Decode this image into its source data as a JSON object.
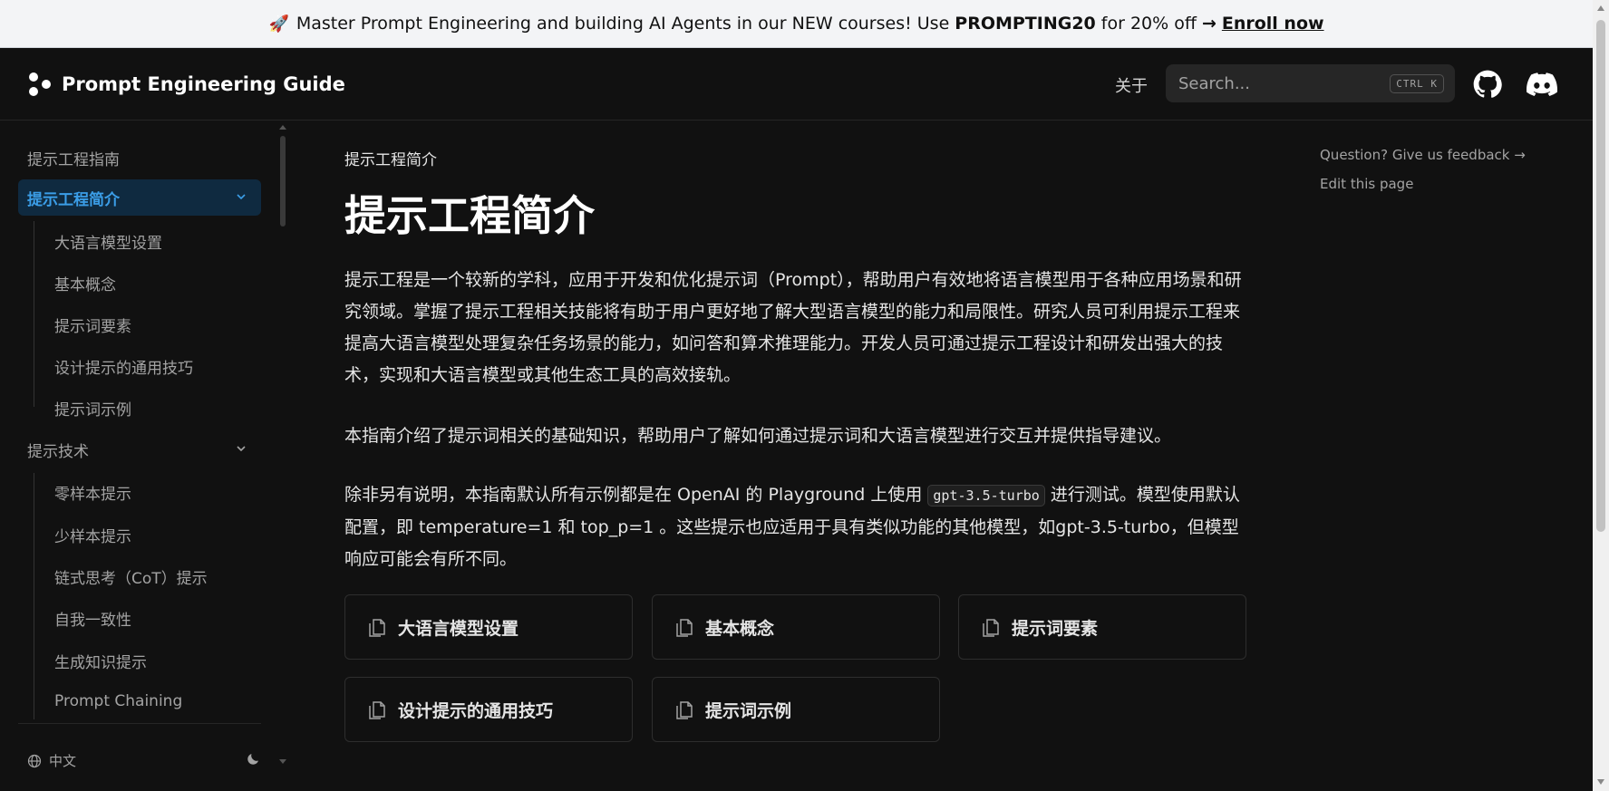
{
  "banner": {
    "icon": "rocket-icon",
    "text_before": "Master Prompt Engineering and building AI Agents in our NEW courses! Use",
    "code": "PROMPTING20",
    "text_after": "for 20% off",
    "arrow": "→",
    "link": "Enroll now"
  },
  "navbar": {
    "logo_name": "Prompt Engineering Guide",
    "about": "关于",
    "search_placeholder": "Search...",
    "shortcut": "CTRL K"
  },
  "sidebar": {
    "items": [
      {
        "label": "提示工程指南"
      },
      {
        "label": "提示工程简介"
      },
      {
        "label": "大语言模型设置"
      },
      {
        "label": "基本概念"
      },
      {
        "label": "提示词要素"
      },
      {
        "label": "设计提示的通用技巧"
      },
      {
        "label": "提示词示例"
      },
      {
        "label": "提示技术"
      },
      {
        "label": "零样本提示"
      },
      {
        "label": "少样本提示"
      },
      {
        "label": "链式思考（CoT）提示"
      },
      {
        "label": "自我一致性"
      },
      {
        "label": "生成知识提示"
      },
      {
        "label": "Prompt Chaining"
      }
    ],
    "language": "中文"
  },
  "main": {
    "breadcrumb": "提示工程简介",
    "title": "提示工程简介",
    "paragraph1": "提示工程是一个较新的学科，应用于开发和优化提示词（Prompt），帮助用户有效地将语言模型用于各种应用场景和研究领域。掌握了提示工程相关技能将有助于用户更好地了解大型语言模型的能力和局限性。研究人员可利用提示工程来提高大语言模型处理复杂任务场景的能力，如问答和算术推理能力。开发人员可通过提示工程设计和研发出强大的技术，实现和大语言模型或其他生态工具的高效接轨。",
    "paragraph2": "本指南介绍了提示词相关的基础知识，帮助用户了解如何通过提示词和大语言模型进行交互并提供指导建议。",
    "paragraph3_before": "除非另有说明，本指南默认所有示例都是在 OpenAI 的 Playground 上使用",
    "paragraph3_code": "gpt-3.5-turbo",
    "paragraph3_after": "进行测试。模型使用默认配置，即 temperature=1 和 top_p=1 。这些提示也应适用于具有类似功能的其他模型，如gpt-3.5-turbo，但模型响应可能会有所不同。",
    "cards": [
      {
        "label": "大语言模型设置"
      },
      {
        "label": "基本概念"
      },
      {
        "label": "提示词要素"
      },
      {
        "label": "设计提示的通用技巧"
      },
      {
        "label": "提示词示例"
      }
    ]
  },
  "toc": {
    "feedback": "Question? Give us feedback →",
    "edit": "Edit this page"
  },
  "colors": {
    "background": "#111111",
    "accent": "#3b9ee8",
    "active_bg": "#0f2a40",
    "banner_bg": "#f3f4f6"
  }
}
